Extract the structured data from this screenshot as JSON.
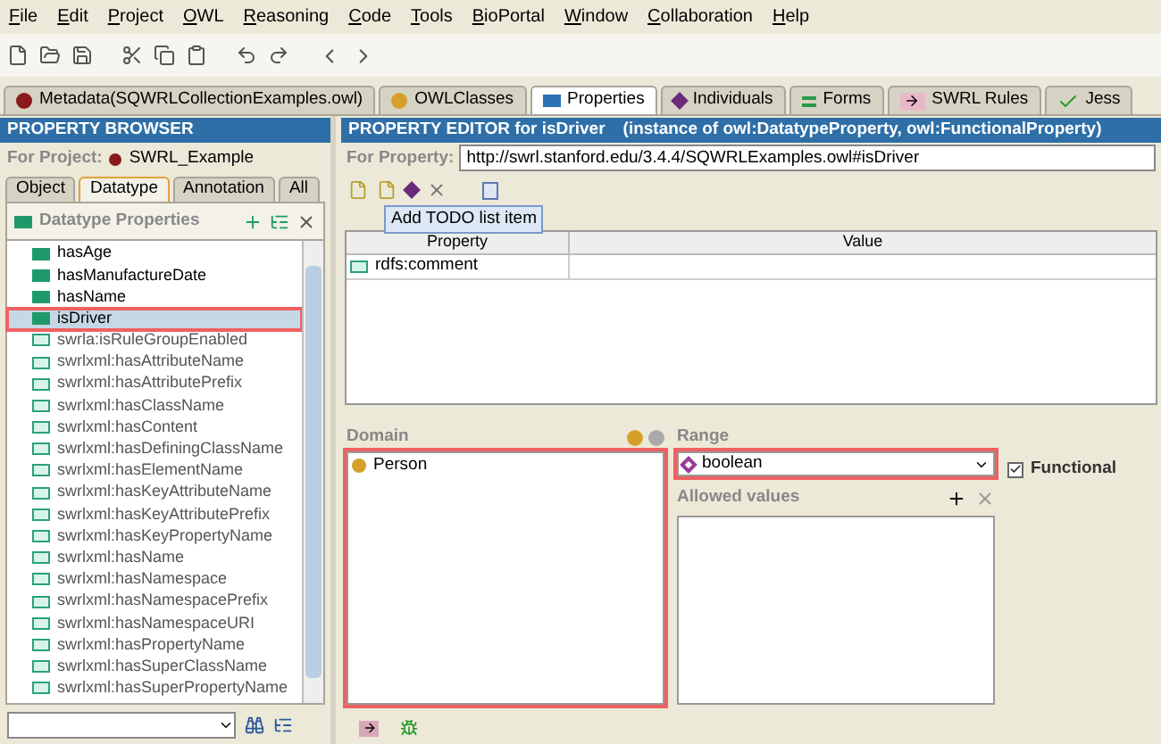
{
  "menu": [
    "File",
    "Edit",
    "Project",
    "OWL",
    "Reasoning",
    "Code",
    "Tools",
    "BioPortal",
    "Window",
    "Collaboration",
    "Help"
  ],
  "tabs": [
    {
      "label": "Metadata(SQWRLCollectionExamples.owl)",
      "kind": "metadata",
      "selected": false
    },
    {
      "label": "OWLClasses",
      "kind": "classes",
      "selected": false
    },
    {
      "label": "Properties",
      "kind": "properties",
      "selected": true
    },
    {
      "label": "Individuals",
      "kind": "individuals",
      "selected": false
    },
    {
      "label": "Forms",
      "kind": "forms",
      "selected": false
    },
    {
      "label": "SWRL Rules",
      "kind": "swrl",
      "selected": false
    },
    {
      "label": "Jess",
      "kind": "jess",
      "selected": false
    }
  ],
  "property_browser": {
    "title": "PROPERTY BROWSER",
    "project_label": "For Project:",
    "project": "SWRL_Example",
    "subtabs": [
      {
        "label": "Object",
        "selected": false
      },
      {
        "label": "Datatype",
        "selected": true
      },
      {
        "label": "Annotation",
        "selected": false
      },
      {
        "label": "All",
        "selected": false
      }
    ],
    "section_title": "Datatype Properties",
    "items": [
      {
        "label": "hasAge",
        "kind": "user",
        "selected": false,
        "highlighted": false
      },
      {
        "label": "hasManufactureDate",
        "kind": "user",
        "selected": false,
        "highlighted": false
      },
      {
        "label": "hasName",
        "kind": "user",
        "selected": false,
        "highlighted": false
      },
      {
        "label": "isDriver",
        "kind": "user",
        "selected": true,
        "highlighted": true
      },
      {
        "label": "swrla:isRuleGroupEnabled",
        "kind": "system",
        "selected": false,
        "highlighted": false
      },
      {
        "label": "swrlxml:hasAttributeName",
        "kind": "system",
        "selected": false,
        "highlighted": false
      },
      {
        "label": "swrlxml:hasAttributePrefix",
        "kind": "system",
        "selected": false,
        "highlighted": false
      },
      {
        "label": "swrlxml:hasClassName",
        "kind": "system",
        "selected": false,
        "highlighted": false
      },
      {
        "label": "swrlxml:hasContent",
        "kind": "system",
        "selected": false,
        "highlighted": false
      },
      {
        "label": "swrlxml:hasDefiningClassName",
        "kind": "system",
        "selected": false,
        "highlighted": false
      },
      {
        "label": "swrlxml:hasElementName",
        "kind": "system",
        "selected": false,
        "highlighted": false
      },
      {
        "label": "swrlxml:hasKeyAttributeName",
        "kind": "system",
        "selected": false,
        "highlighted": false
      },
      {
        "label": "swrlxml:hasKeyAttributePrefix",
        "kind": "system",
        "selected": false,
        "highlighted": false
      },
      {
        "label": "swrlxml:hasKeyPropertyName",
        "kind": "system",
        "selected": false,
        "highlighted": false
      },
      {
        "label": "swrlxml:hasName",
        "kind": "system",
        "selected": false,
        "highlighted": false
      },
      {
        "label": "swrlxml:hasNamespace",
        "kind": "system",
        "selected": false,
        "highlighted": false
      },
      {
        "label": "swrlxml:hasNamespacePrefix",
        "kind": "system",
        "selected": false,
        "highlighted": false
      },
      {
        "label": "swrlxml:hasNamespaceURI",
        "kind": "system",
        "selected": false,
        "highlighted": false
      },
      {
        "label": "swrlxml:hasPropertyName",
        "kind": "system",
        "selected": false,
        "highlighted": false
      },
      {
        "label": "swrlxml:hasSuperClassName",
        "kind": "system",
        "selected": false,
        "highlighted": false
      },
      {
        "label": "swrlxml:hasSuperPropertyName",
        "kind": "system",
        "selected": false,
        "highlighted": false
      }
    ]
  },
  "property_editor": {
    "title": "PROPERTY EDITOR for isDriver",
    "subtitle": "(instance of owl:DatatypeProperty, owl:FunctionalProperty)",
    "property_label": "For Property:",
    "property_uri": "http://swrl.stanford.edu/3.4.4/SQWRLExamples.owl#isDriver",
    "tooltip": "Add TODO list item",
    "table": {
      "columns": [
        "Property",
        "Value"
      ],
      "rows": [
        {
          "property": "rdfs:comment"
        }
      ]
    },
    "domain": {
      "label": "Domain",
      "highlighted": true,
      "items": [
        {
          "label": "Person"
        }
      ]
    },
    "range": {
      "label": "Range",
      "value": "boolean",
      "highlighted": true
    },
    "functional": {
      "label": "Functional",
      "checked": true
    },
    "allowed_values": {
      "label": "Allowed values"
    }
  }
}
